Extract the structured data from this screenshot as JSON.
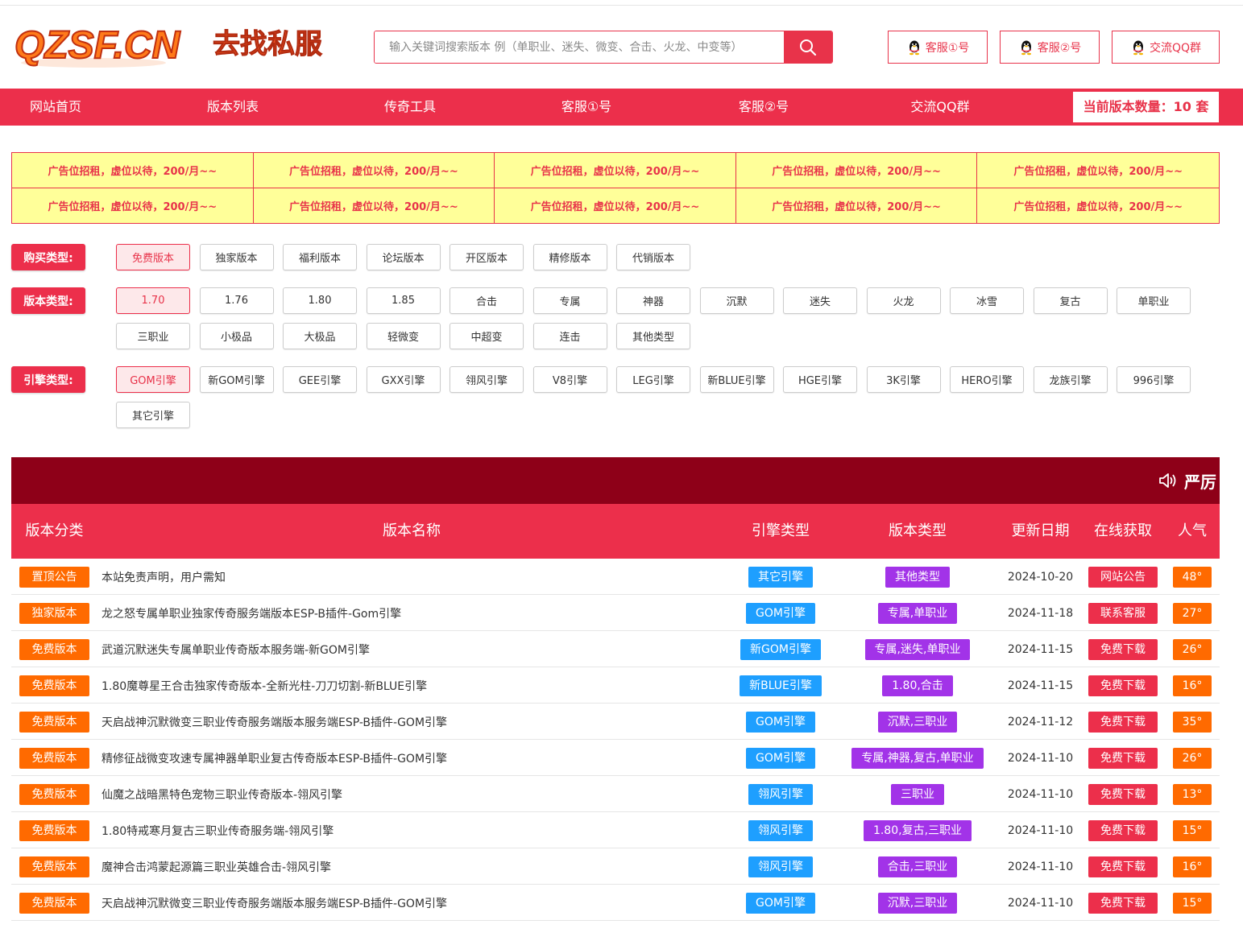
{
  "header": {
    "logo_main": "QZSF.CN",
    "logo_sub": "去找私服",
    "search_placeholder": "输入关键词搜索版本 例（单职业、迷失、微变、合击、火龙、中变等）",
    "buttons": [
      "客服①号",
      "客服②号",
      "交流QQ群"
    ]
  },
  "nav": {
    "items": [
      "网站首页",
      "版本列表",
      "传奇工具",
      "客服①号",
      "客服②号",
      "交流QQ群"
    ],
    "count_label": "当前版本数量：10 套"
  },
  "ads": {
    "text": "广告位招租，虚位以待，200/月~~"
  },
  "filters": {
    "buy": {
      "label": "购买类型:",
      "options": [
        "免费版本",
        "独家版本",
        "福利版本",
        "论坛版本",
        "开区版本",
        "精修版本",
        "代销版本"
      ],
      "active": "免费版本"
    },
    "version": {
      "label": "版本类型:",
      "options": [
        "1.70",
        "1.76",
        "1.80",
        "1.85",
        "合击",
        "专属",
        "神器",
        "沉默",
        "迷失",
        "火龙",
        "冰雪",
        "复古",
        "单职业",
        "三职业",
        "小极品",
        "大极品",
        "轻微变",
        "中超变",
        "连击",
        "其他类型"
      ],
      "active": "1.70"
    },
    "engine": {
      "label": "引擎类型:",
      "options": [
        "GOM引擎",
        "新GOM引擎",
        "GEE引擎",
        "GXX引擎",
        "翎风引擎",
        "V8引擎",
        "LEG引擎",
        "新BLUE引擎",
        "HGE引擎",
        "3K引擎",
        "HERO引擎",
        "龙族引擎",
        "996引擎",
        "其它引擎"
      ],
      "active": "GOM引擎"
    }
  },
  "marquee": {
    "text": "严厉"
  },
  "table": {
    "headers": [
      "版本分类",
      "版本名称",
      "引擎类型",
      "版本类型",
      "更新日期",
      "在线获取",
      "人气"
    ],
    "rows": [
      {
        "cat": "置顶公告",
        "name": "本站免责声明，用户需知",
        "engine": "其它引擎",
        "type": "其他类型",
        "date": "2024-10-20",
        "get": "网站公告",
        "pop": "48°"
      },
      {
        "cat": "独家版本",
        "name": "龙之怒专属单职业独家传奇服务端版本ESP-B插件-Gom引擎",
        "engine": "GOM引擎",
        "type": "专属,单职业",
        "date": "2024-11-18",
        "get": "联系客服",
        "pop": "27°"
      },
      {
        "cat": "免费版本",
        "name": "武道沉默迷失专属单职业传奇版本服务端-新GOM引擎",
        "engine": "新GOM引擎",
        "type": "专属,迷失,单职业",
        "date": "2024-11-15",
        "get": "免费下载",
        "pop": "26°"
      },
      {
        "cat": "免费版本",
        "name": "1.80魔尊星王合击独家传奇版本-全新光柱-刀刀切割-新BLUE引擎",
        "engine": "新BLUE引擎",
        "type": "1.80,合击",
        "date": "2024-11-15",
        "get": "免费下载",
        "pop": "16°"
      },
      {
        "cat": "免费版本",
        "name": "天启战神沉默微变三职业传奇服务端版本服务端ESP-B插件-GOM引擎",
        "engine": "GOM引擎",
        "type": "沉默,三职业",
        "date": "2024-11-12",
        "get": "免费下载",
        "pop": "35°"
      },
      {
        "cat": "免费版本",
        "name": "精修征战微变攻速专属神器单职业复古传奇版本ESP-B插件-GOM引擎",
        "engine": "GOM引擎",
        "type": "专属,神器,复古,单职业",
        "date": "2024-11-10",
        "get": "免费下载",
        "pop": "26°"
      },
      {
        "cat": "免费版本",
        "name": "仙魔之战暗黑特色宠物三职业传奇版本-翎风引擎",
        "engine": "翎风引擎",
        "type": "三职业",
        "date": "2024-11-10",
        "get": "免费下载",
        "pop": "13°"
      },
      {
        "cat": "免费版本",
        "name": "1.80特戒寒月复古三职业传奇服务端-翎风引擎",
        "engine": "翎风引擎",
        "type": "1.80,复古,三职业",
        "date": "2024-11-10",
        "get": "免费下载",
        "pop": "15°"
      },
      {
        "cat": "免费版本",
        "name": "魔神合击鸿蒙起源篇三职业英雄合击-翎风引擎",
        "engine": "翎风引擎",
        "type": "合击,三职业",
        "date": "2024-11-10",
        "get": "免费下载",
        "pop": "16°"
      },
      {
        "cat": "免费版本",
        "name": "天启战神沉默微变三职业传奇服务端版本服务端ESP-B插件-GOM引擎",
        "engine": "GOM引擎",
        "type": "沉默,三职业",
        "date": "2024-11-10",
        "get": "免费下载",
        "pop": "15°"
      }
    ]
  },
  "colors": {
    "accent": "#ec2f4b",
    "banner": "#8e0018",
    "orange": "#ff6a00",
    "blue": "#1e9fff",
    "purple": "#a233e8",
    "ad_bg": "#ffff99"
  }
}
